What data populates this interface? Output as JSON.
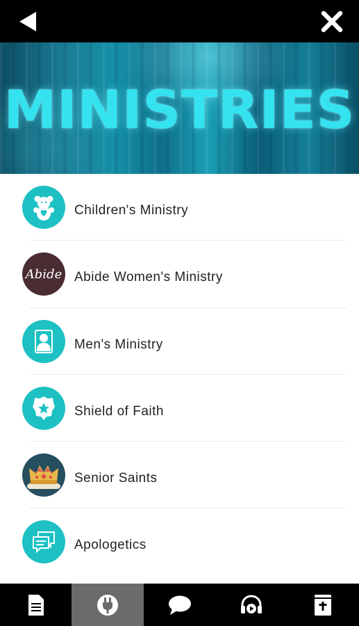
{
  "header": {
    "back_icon": "back-arrow-icon",
    "close_icon": "close-x-icon"
  },
  "banner": {
    "title": "MINISTRIES"
  },
  "ministries": [
    {
      "label": "Children's Ministry",
      "icon": "teddy-bear-icon",
      "icon_bg": "#1dc1c3"
    },
    {
      "label": "Abide Women's Ministry",
      "icon": "abide-logo",
      "icon_text": "Abide",
      "icon_bg": "#4a2c33"
    },
    {
      "label": "Men's Ministry",
      "icon": "person-icon",
      "icon_bg": "#1dc1c3"
    },
    {
      "label": "Shield of Faith",
      "icon": "badge-star-icon",
      "icon_bg": "#1dc1c3"
    },
    {
      "label": "Senior Saints",
      "icon": "crown-icon",
      "icon_bg": "#254e5e"
    },
    {
      "label": "Apologetics",
      "icon": "chat-bubbles-icon",
      "icon_bg": "#1dc1c3"
    }
  ],
  "tabbar": {
    "tabs": [
      {
        "icon": "document-icon",
        "active": false
      },
      {
        "icon": "plug-icon",
        "active": true
      },
      {
        "icon": "chat-bubble-icon",
        "active": false
      },
      {
        "icon": "headphones-play-icon",
        "active": false
      },
      {
        "icon": "bible-icon",
        "active": false
      }
    ]
  },
  "colors": {
    "accent_teal": "#1dc1c3",
    "bar_black": "#000000",
    "active_tab": "#6b6b6b"
  }
}
